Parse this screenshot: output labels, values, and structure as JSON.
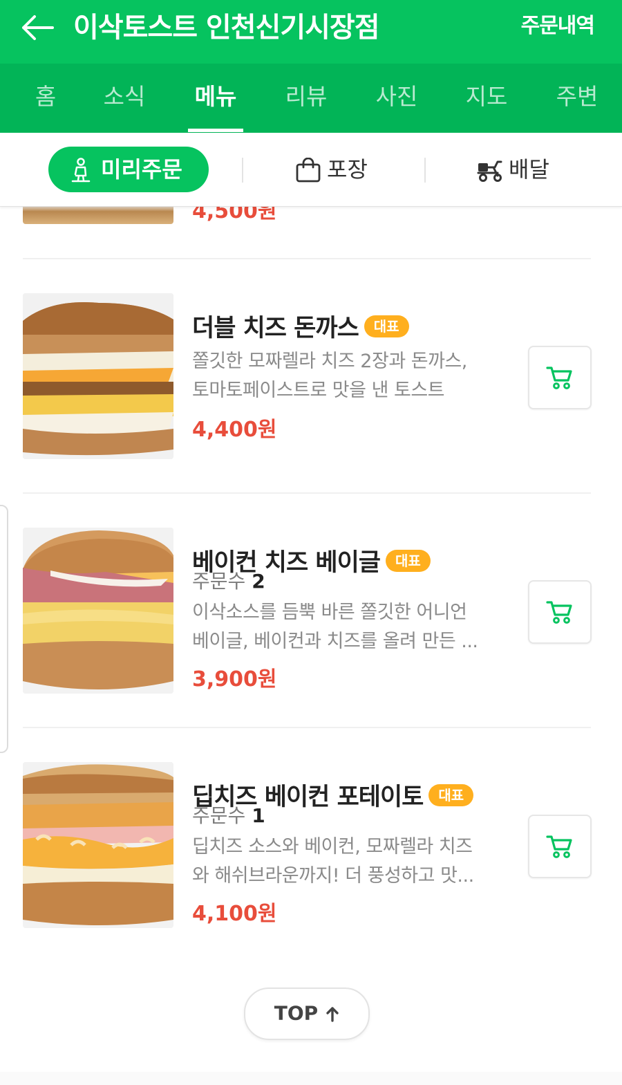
{
  "header": {
    "store_title": "이삭토스트 인천신기시장점",
    "order_history_label": "주문내역"
  },
  "tabs": [
    {
      "label": "홈",
      "active": false
    },
    {
      "label": "소식",
      "active": false
    },
    {
      "label": "메뉴",
      "active": true
    },
    {
      "label": "리뷰",
      "active": false
    },
    {
      "label": "사진",
      "active": false
    },
    {
      "label": "지도",
      "active": false
    },
    {
      "label": "주변",
      "active": false
    }
  ],
  "order_types": {
    "preorder": "미리주문",
    "takeout": "포장",
    "delivery": "배달"
  },
  "partial_item": {
    "price": "4,500원"
  },
  "menu_items": [
    {
      "name": "더블 치즈 돈까스",
      "badge": "대표",
      "desc_line1": "쫄깃한 모짜렐라 치즈 2장과 돈까스,",
      "desc_line2": "토마토페이스트로 맛을 낸 토스트",
      "price": "4,400원"
    },
    {
      "name": "베이컨 치즈 베이글",
      "badge": "대표",
      "order_count_label": "주문수",
      "order_count": "2",
      "desc_line1": "이삭소스를 듬뿍 바른 쫄깃한 어니언",
      "desc_line2": "베이글, 베이컨과 치즈를 올려 만든 ...",
      "price": "3,900원"
    },
    {
      "name": "딥치즈 베이컨 포테이토",
      "badge": "대표",
      "order_count_label": "주문수",
      "order_count": "1",
      "desc_line1": "딥치즈 소스와 베이컨, 모짜렐라 치즈",
      "desc_line2": "와 해쉬브라운까지! 더 풍성하고 맛...",
      "price": "4,100원"
    }
  ],
  "top_button": {
    "label": "TOP"
  },
  "colors": {
    "brand_green": "#06c35f",
    "tab_green": "#02b457",
    "price_red": "#e84d3b",
    "badge_orange": "#ffaf1e"
  },
  "icons": {
    "back": "arrow-left-icon",
    "preorder": "person-walking-icon",
    "takeout": "shopping-bag-icon",
    "delivery": "delivery-scooter-icon",
    "cart": "cart-icon",
    "top": "arrow-up-icon"
  }
}
